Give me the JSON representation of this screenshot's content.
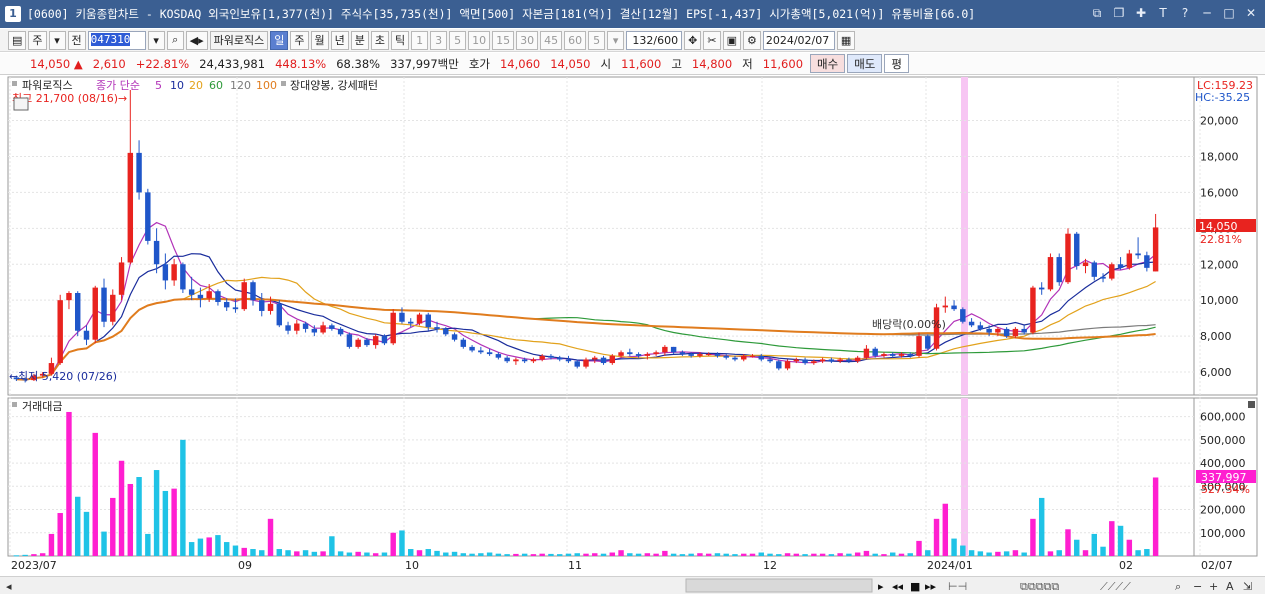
{
  "window": {
    "number": "1",
    "title": "[0600] 키움종합차트 - KOSDAQ 외국인보유[1,377(천)] 주식수[35,735(천)] 액면[500] 자본금[181(억)] 결산[12월] EPS[-1,437] 시가총액[5,021(억)] 유통비율[66.0]",
    "buttons": [
      "⧉",
      "❐",
      "✚",
      "T",
      "?",
      "─",
      "□",
      "✕"
    ]
  },
  "toolbar": {
    "market_label": "주",
    "prev_label": "전",
    "stock_code": "047310",
    "indicator_label": "파워로직스",
    "periods": [
      "일",
      "주",
      "월",
      "년",
      "분",
      "초",
      "틱"
    ],
    "active_period": "일",
    "intervals": [
      "1",
      "3",
      "5",
      "10",
      "15",
      "30",
      "45",
      "60"
    ],
    "interval_value": "5",
    "count": "132/600",
    "date": "2024/02/07"
  },
  "quote": {
    "price": "14,050",
    "arrow": "▲",
    "change": "2,610",
    "change_pct": "+22.81%",
    "volume": "24,433,981",
    "vol_ratio": "448.13%",
    "turnover": "68.38%",
    "amount": "337,997백만",
    "bid_label": "호가",
    "bid": "14,060",
    "ask": "14,050",
    "open_label": "시",
    "open": "11,600",
    "high_label": "고",
    "high": "14,800",
    "low_label": "저",
    "low": "11,600",
    "buy_label": "매수",
    "sell_label": "매도",
    "flat_label": "평"
  },
  "price_panel": {
    "legend_name": "파워로직스",
    "legend_ma": "종가 단순",
    "ma_periods": [
      {
        "label": "5",
        "color": "#b233b8"
      },
      {
        "label": "10",
        "color": "#1a2d9c"
      },
      {
        "label": "20",
        "color": "#e2a21c"
      },
      {
        "label": "60",
        "color": "#2e9a3a"
      },
      {
        "label": "120",
        "color": "#7b7b7b"
      },
      {
        "label": "100",
        "color": "#e07c1e"
      }
    ],
    "pattern_label": "장대양봉, 강세패턴",
    "lc": "LC:159.23",
    "hc": "HC:-35.25",
    "current_price_tag": "14,050",
    "current_pct_tag": "22.81%",
    "high_annotation": "최고 21,700 (08/16)",
    "low_annotation": "최저 5,420 (07/26)",
    "dividend_annotation": "배당락(0.00%)",
    "y_ticks": [
      "20,000",
      "18,000",
      "16,000",
      "14,000",
      "12,000",
      "10,000",
      "8,000",
      "6,000"
    ]
  },
  "volume_panel": {
    "legend_name": "거래대금",
    "current_tag": "337,997",
    "current_pct_tag": "527.34%",
    "y_ticks": [
      "600,000",
      "500,000",
      "400,000",
      "300,000",
      "200,000",
      "100,000"
    ]
  },
  "x_axis": {
    "labels": [
      "2023/07",
      "09",
      "10",
      "11",
      "12",
      "2024/01",
      "02",
      "02/07"
    ]
  },
  "colors": {
    "up": "#e8231f",
    "down": "#1f56c9",
    "vol_up": "#ff1fd0",
    "vol_down": "#1fc3e6",
    "highlight": "#f7c6f3",
    "title_bg": "#3b5f92"
  },
  "chart_data": {
    "type": "candlestick",
    "price_ylim": [
      5000,
      21700
    ],
    "volume_ylim": [
      0,
      650000
    ],
    "candles": [
      [
        5700,
        5800,
        5500,
        5600
      ],
      [
        5600,
        5700,
        5420,
        5550
      ],
      [
        5550,
        5900,
        5500,
        5800
      ],
      [
        5800,
        6000,
        5700,
        5900
      ],
      [
        5900,
        6800,
        5800,
        6500
      ],
      [
        6500,
        10300,
        6400,
        10000
      ],
      [
        10000,
        10500,
        9500,
        10400
      ],
      [
        10400,
        10500,
        8000,
        8300
      ],
      [
        8300,
        8600,
        7500,
        7800
      ],
      [
        7800,
        10800,
        7600,
        10700
      ],
      [
        10700,
        11200,
        8500,
        8800
      ],
      [
        8800,
        10600,
        8600,
        10300
      ],
      [
        10300,
        12400,
        10000,
        12100
      ],
      [
        12100,
        21700,
        12000,
        18200
      ],
      [
        18200,
        18900,
        15600,
        16000
      ],
      [
        16000,
        16200,
        13100,
        13300
      ],
      [
        13300,
        14000,
        11500,
        12000
      ],
      [
        12000,
        12600,
        10600,
        11100
      ],
      [
        11100,
        12300,
        10800,
        12000
      ],
      [
        12000,
        12100,
        10400,
        10600
      ],
      [
        10600,
        11300,
        10000,
        10300
      ],
      [
        10300,
        10700,
        9600,
        10100
      ],
      [
        10100,
        10900,
        9900,
        10500
      ],
      [
        10500,
        10600,
        9700,
        9900
      ],
      [
        9900,
        10100,
        9400,
        9600
      ],
      [
        9600,
        10100,
        9300,
        9500
      ],
      [
        9500,
        11200,
        9400,
        11000
      ],
      [
        11000,
        11100,
        9700,
        10000
      ],
      [
        10000,
        10400,
        9100,
        9400
      ],
      [
        9400,
        10200,
        9200,
        9800
      ],
      [
        9800,
        10000,
        8500,
        8600
      ],
      [
        8600,
        8800,
        8100,
        8300
      ],
      [
        8300,
        8900,
        8100,
        8700
      ],
      [
        8700,
        8800,
        8200,
        8400
      ],
      [
        8400,
        8600,
        8000,
        8200
      ],
      [
        8200,
        8800,
        8100,
        8600
      ],
      [
        8600,
        8700,
        8300,
        8400
      ],
      [
        8400,
        8500,
        8000,
        8100
      ],
      [
        8100,
        8200,
        7300,
        7400
      ],
      [
        7400,
        7900,
        7300,
        7800
      ],
      [
        7800,
        7900,
        7400,
        7500
      ],
      [
        7500,
        8100,
        7300,
        8000
      ],
      [
        8000,
        8100,
        7500,
        7600
      ],
      [
        7600,
        9500,
        7500,
        9300
      ],
      [
        9300,
        9600,
        8700,
        8800
      ],
      [
        8800,
        9000,
        8500,
        8700
      ],
      [
        8700,
        9300,
        8600,
        9200
      ],
      [
        9200,
        9300,
        8300,
        8500
      ],
      [
        8500,
        8800,
        8200,
        8400
      ],
      [
        8400,
        8500,
        8000,
        8100
      ],
      [
        8100,
        8200,
        7700,
        7800
      ],
      [
        7800,
        7900,
        7300,
        7400
      ],
      [
        7400,
        7500,
        7100,
        7200
      ],
      [
        7200,
        7400,
        7000,
        7100
      ],
      [
        7100,
        7300,
        6900,
        7000
      ],
      [
        7000,
        7100,
        6700,
        6800
      ],
      [
        6800,
        6900,
        6500,
        6600
      ],
      [
        6600,
        6800,
        6400,
        6700
      ],
      [
        6700,
        6800,
        6500,
        6600
      ],
      [
        6600,
        6800,
        6500,
        6700
      ],
      [
        6700,
        7000,
        6600,
        6900
      ],
      [
        6900,
        7000,
        6700,
        6800
      ],
      [
        6800,
        6900,
        6600,
        6700
      ],
      [
        6700,
        6900,
        6500,
        6600
      ],
      [
        6600,
        6700,
        6200,
        6300
      ],
      [
        6300,
        6800,
        6200,
        6700
      ],
      [
        6700,
        6900,
        6500,
        6800
      ],
      [
        6800,
        6900,
        6400,
        6500
      ],
      [
        6500,
        7000,
        6400,
        6900
      ],
      [
        6900,
        7200,
        6800,
        7100
      ],
      [
        7100,
        7300,
        6900,
        7000
      ],
      [
        7000,
        7100,
        6800,
        6900
      ],
      [
        6900,
        7100,
        6700,
        7000
      ],
      [
        7000,
        7200,
        6900,
        7100
      ],
      [
        7100,
        7500,
        6900,
        7400
      ],
      [
        7400,
        7400,
        7000,
        7100
      ],
      [
        7100,
        7200,
        6900,
        7000
      ],
      [
        7000,
        7100,
        6800,
        6900
      ],
      [
        6900,
        7100,
        6800,
        7000
      ],
      [
        7000,
        7100,
        6900,
        7000
      ],
      [
        7000,
        7100,
        6800,
        6900
      ],
      [
        6900,
        7000,
        6700,
        6800
      ],
      [
        6800,
        6900,
        6600,
        6700
      ],
      [
        6700,
        7000,
        6600,
        6900
      ],
      [
        6900,
        7000,
        6800,
        6900
      ],
      [
        6900,
        7000,
        6600,
        6700
      ],
      [
        6700,
        6800,
        6500,
        6600
      ],
      [
        6600,
        6700,
        6100,
        6200
      ],
      [
        6200,
        6700,
        6100,
        6600
      ],
      [
        6600,
        6800,
        6500,
        6700
      ],
      [
        6700,
        6800,
        6400,
        6500
      ],
      [
        6500,
        6700,
        6400,
        6600
      ],
      [
        6600,
        6800,
        6500,
        6700
      ],
      [
        6700,
        6800,
        6500,
        6600
      ],
      [
        6600,
        6800,
        6500,
        6700
      ],
      [
        6700,
        6800,
        6500,
        6600
      ],
      [
        6600,
        6900,
        6500,
        6800
      ],
      [
        6800,
        7500,
        6700,
        7300
      ],
      [
        7300,
        7400,
        6800,
        6900
      ],
      [
        6900,
        7100,
        6800,
        7000
      ],
      [
        7000,
        7100,
        6800,
        6900
      ],
      [
        6900,
        7100,
        6800,
        7000
      ],
      [
        7000,
        7100,
        6800,
        6900
      ],
      [
        6900,
        8200,
        6800,
        8000
      ],
      [
        8000,
        8100,
        7200,
        7300
      ],
      [
        7300,
        9800,
        7200,
        9600
      ],
      [
        9600,
        10200,
        9300,
        9700
      ],
      [
        9700,
        10000,
        9400,
        9500
      ],
      [
        9500,
        9600,
        8700,
        8800
      ],
      [
        8800,
        9000,
        8500,
        8600
      ],
      [
        8600,
        8800,
        8300,
        8400
      ],
      [
        8400,
        8600,
        8000,
        8200
      ],
      [
        8200,
        8500,
        8000,
        8400
      ],
      [
        8400,
        8500,
        7900,
        8000
      ],
      [
        8000,
        8500,
        7900,
        8400
      ],
      [
        8400,
        8600,
        8100,
        8200
      ],
      [
        8200,
        10800,
        8100,
        10700
      ],
      [
        10700,
        11000,
        10300,
        10600
      ],
      [
        10600,
        12600,
        10500,
        12400
      ],
      [
        12400,
        12600,
        10800,
        11000
      ],
      [
        11000,
        14000,
        10900,
        13700
      ],
      [
        13700,
        13800,
        11700,
        11900
      ],
      [
        11900,
        12300,
        11500,
        12100
      ],
      [
        12100,
        12200,
        11100,
        11300
      ],
      [
        11300,
        11500,
        11000,
        11200
      ],
      [
        11200,
        12100,
        11100,
        12000
      ],
      [
        12000,
        12400,
        11700,
        11800
      ],
      [
        11800,
        12800,
        11700,
        12600
      ],
      [
        12600,
        13500,
        12300,
        12500
      ],
      [
        12500,
        12700,
        11600,
        11800
      ],
      [
        11600,
        14800,
        11600,
        14050
      ]
    ],
    "amounts": [
      3000,
      5000,
      8000,
      12000,
      95000,
      185000,
      620000,
      255000,
      190000,
      530000,
      105000,
      250000,
      410000,
      310000,
      340000,
      95000,
      370000,
      280000,
      290000,
      500000,
      60000,
      75000,
      80000,
      90000,
      60000,
      45000,
      35000,
      30000,
      25000,
      160000,
      30000,
      25000,
      20000,
      25000,
      18000,
      20000,
      85000,
      20000,
      15000,
      18000,
      15000,
      12000,
      15000,
      100000,
      110000,
      30000,
      25000,
      30000,
      22000,
      15000,
      18000,
      12000,
      10000,
      12000,
      15000,
      10000,
      8000,
      9000,
      10000,
      8000,
      10000,
      9000,
      8000,
      10000,
      12000,
      10000,
      12000,
      10000,
      15000,
      25000,
      12000,
      10000,
      12000,
      10000,
      22000,
      10000,
      8000,
      10000,
      12000,
      10000,
      12000,
      10000,
      8000,
      10000,
      10000,
      15000,
      10000,
      8000,
      12000,
      10000,
      8000,
      10000,
      10000,
      8000,
      12000,
      10000,
      15000,
      22000,
      10000,
      8000,
      15000,
      10000,
      12000,
      65000,
      25000,
      160000,
      225000,
      75000,
      45000,
      25000,
      20000,
      15000,
      18000,
      20000,
      25000,
      15000,
      160000,
      250000,
      20000,
      25000,
      115000,
      70000,
      25000,
      95000,
      40000,
      150000,
      130000,
      70000,
      25000,
      30000,
      337997
    ]
  }
}
